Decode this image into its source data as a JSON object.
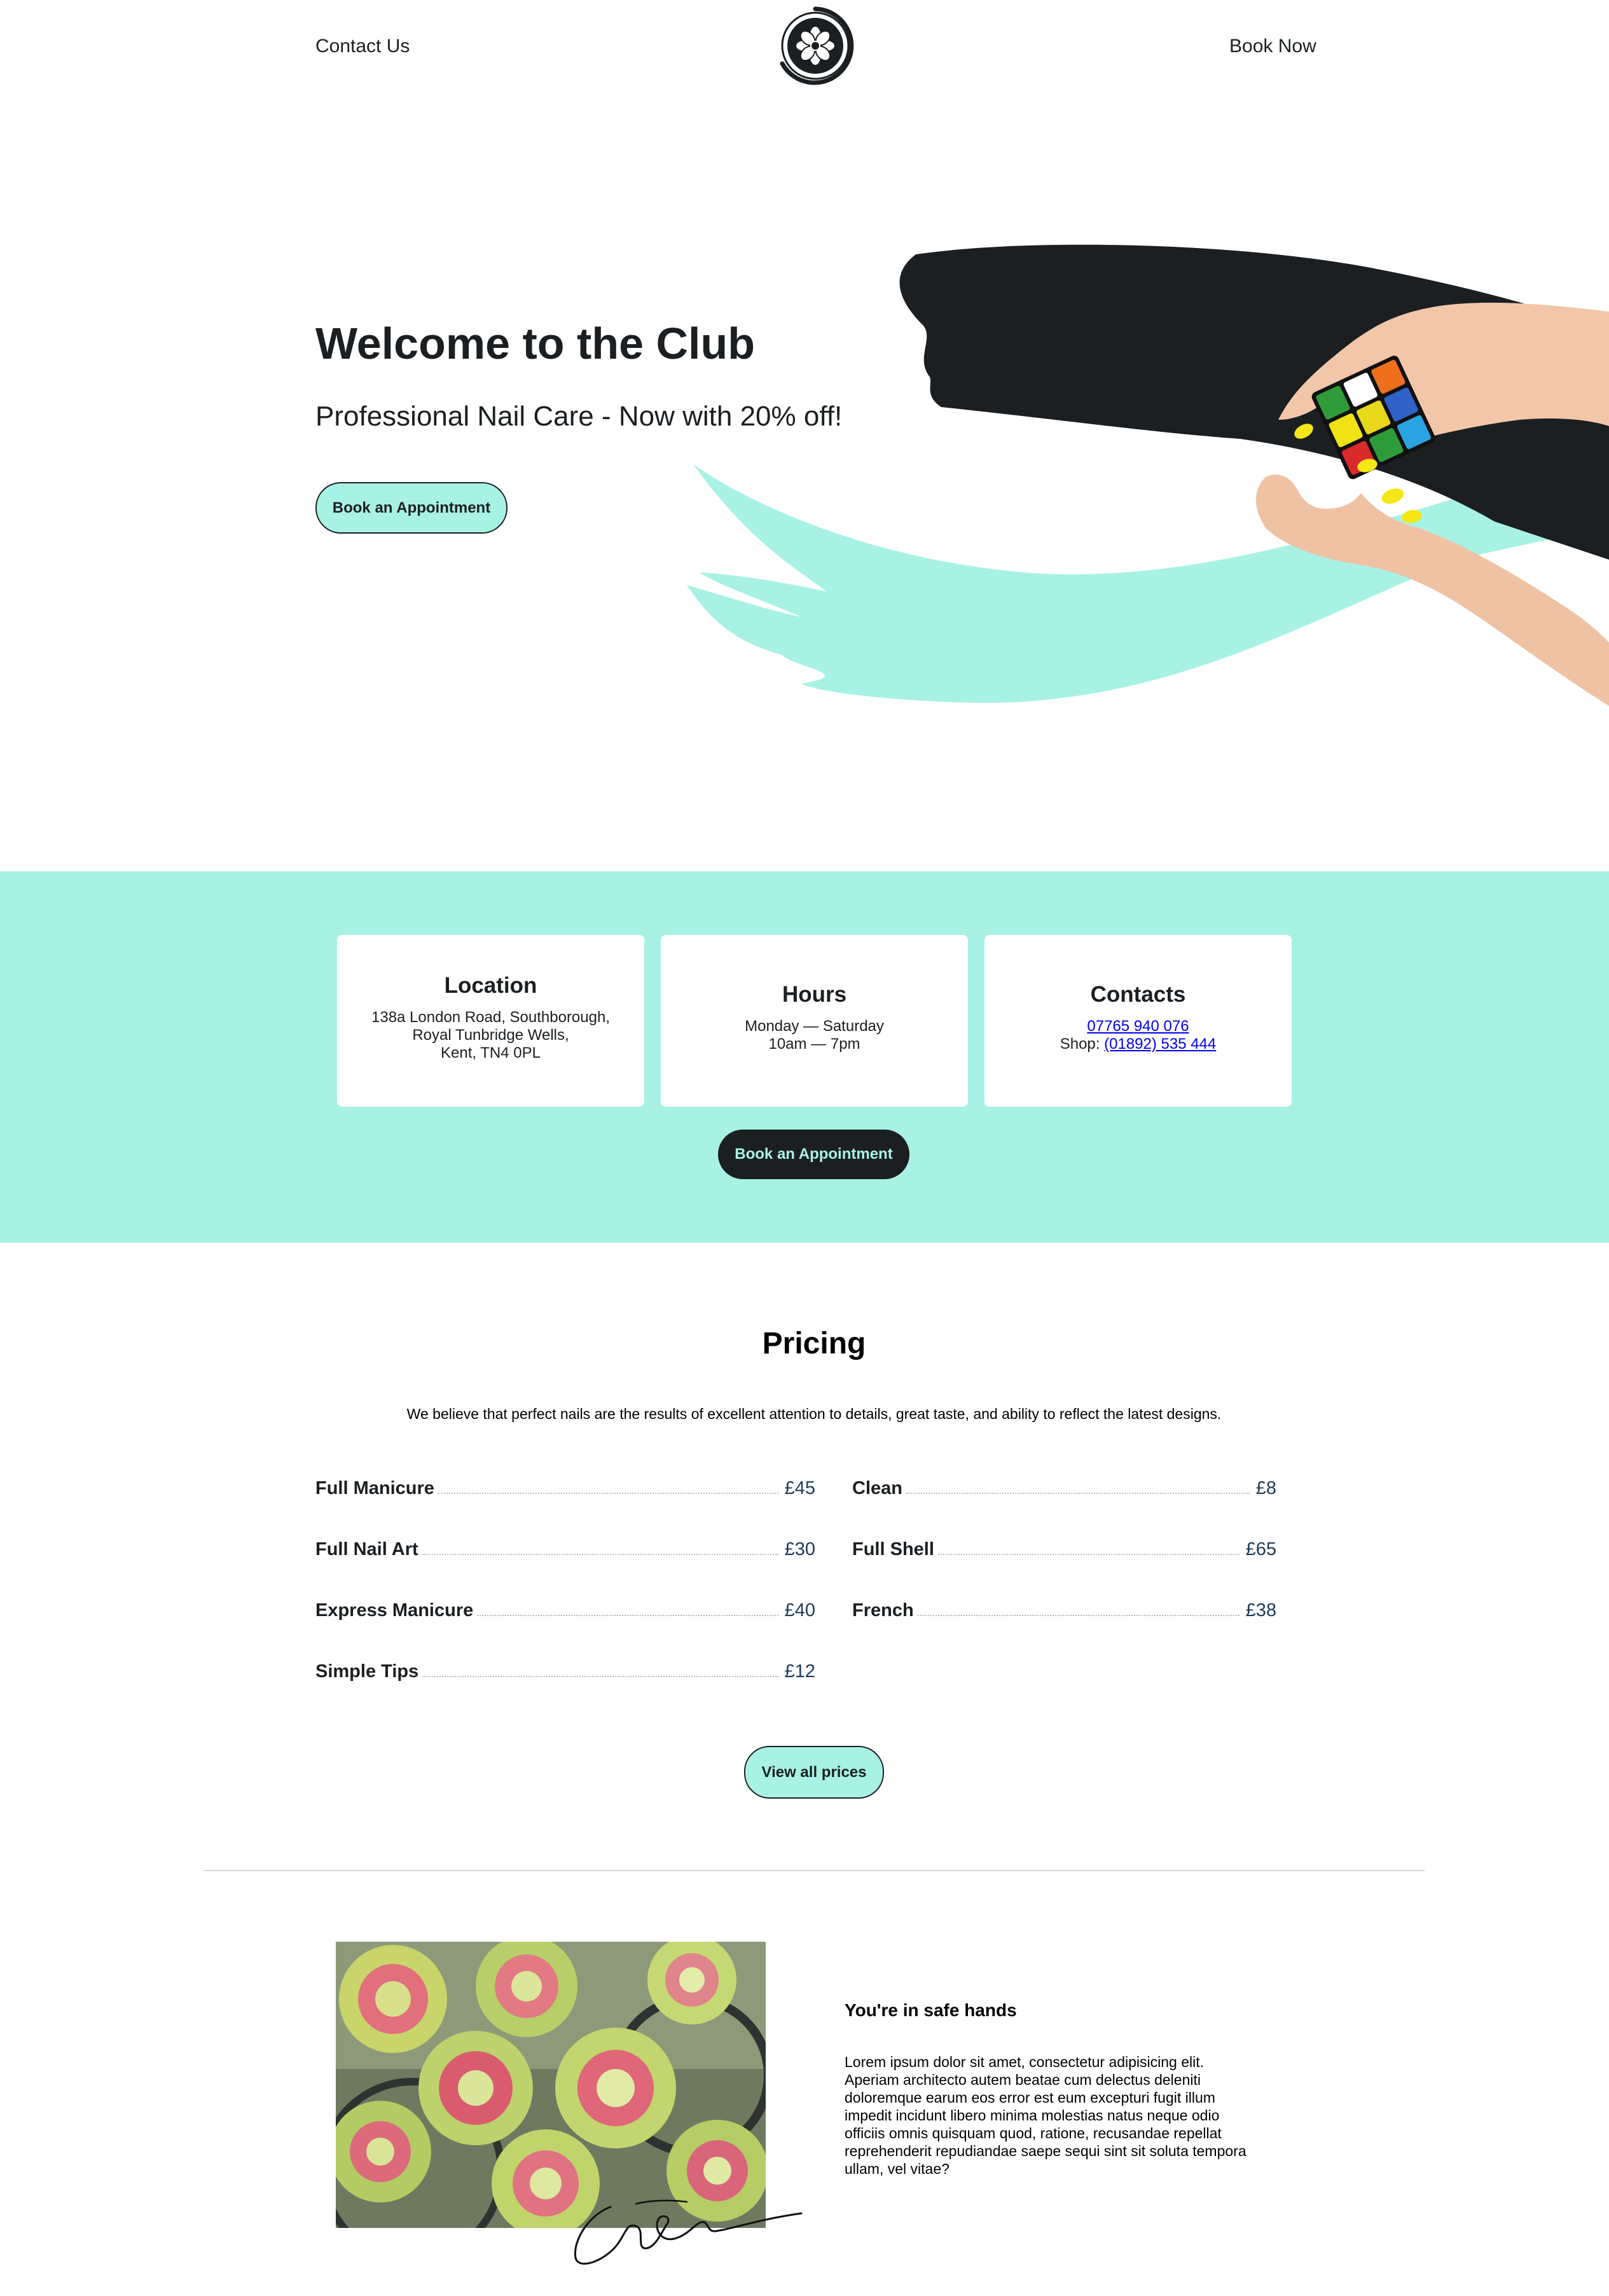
{
  "header": {
    "contact_label": "Contact Us",
    "book_label": "Book Now"
  },
  "hero": {
    "title": "Welcome to the Club",
    "subtitle": "Professional Nail Care - Now with 20% off!",
    "cta_label": "Book an Appointment"
  },
  "info": {
    "location": {
      "title": "Location",
      "line1": "138a London Road, Southborough,",
      "line2": "Royal Tunbridge Wells,",
      "line3": "Kent, TN4 0PL"
    },
    "hours": {
      "title": "Hours",
      "days": "Monday — Saturday",
      "times": "10am — 7pm"
    },
    "contacts": {
      "title": "Contacts",
      "mobile": "07765 940 076",
      "shop_prefix": "Shop: ",
      "shop": "(01892) 535 444"
    },
    "cta_label": "Book an Appointment"
  },
  "pricing": {
    "title": "Pricing",
    "description": "We believe that perfect nails are the results of excellent attention to details, great taste, and ability to reflect the latest designs.",
    "left": [
      {
        "name": "Full Manicure",
        "price": "£45"
      },
      {
        "name": "Full Nail Art",
        "price": "£30"
      },
      {
        "name": "Express Manicure",
        "price": "£40"
      },
      {
        "name": "Simple Tips",
        "price": "£12"
      }
    ],
    "right": [
      {
        "name": "Clean",
        "price": "£8"
      },
      {
        "name": "Full Shell",
        "price": "£65"
      },
      {
        "name": "French",
        "price": "£38"
      }
    ],
    "cta_label": "View all prices"
  },
  "about": {
    "title": "You're in safe hands",
    "text": "Lorem ipsum dolor sit amet, consectetur adipisicing elit. Aperiam architecto autem beatae cum delectus deleniti doloremque earum eos error est eum excepturi fugit illum impedit incidunt libero minima molestias natus neque odio officiis omnis quisquam quod, ratione, recusandae repellat reprehenderit repudiandae saepe sequi sint sit soluta tempora ullam, vel vitae?"
  },
  "colors": {
    "mint": "#a8f2e5",
    "dark": "#1b1f22",
    "price_blue": "#1d3a58",
    "link_blue": "#0000ee"
  },
  "icons": {
    "logo": "flower-logo-icon"
  }
}
